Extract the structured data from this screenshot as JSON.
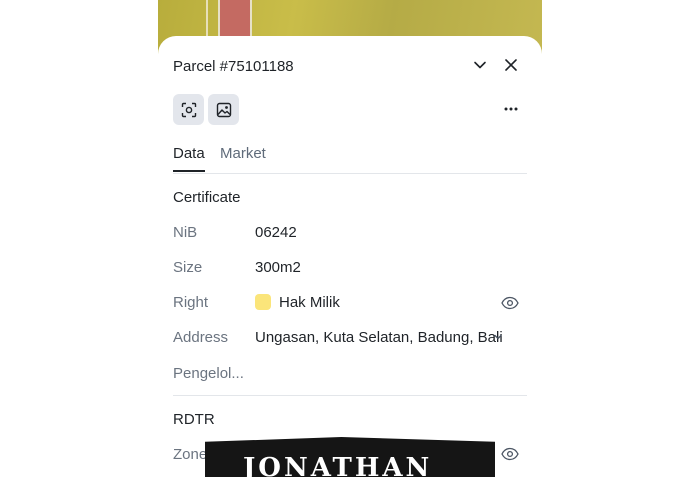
{
  "header": {
    "title": "Parcel #75101188"
  },
  "toolbar": {
    "select_icon": "focus-select-icon",
    "image_icon": "image-icon",
    "more_icon": "more-dots-icon"
  },
  "tabs": [
    {
      "label": "Data",
      "active": true
    },
    {
      "label": "Market",
      "active": false
    }
  ],
  "certificate": {
    "heading": "Certificate",
    "fields": [
      {
        "label": "NiB",
        "value": "06242"
      },
      {
        "label": "Size",
        "value": "300m2"
      },
      {
        "label": "Right",
        "value": "Hak Milik",
        "swatch_color": "#fbe57a"
      },
      {
        "label": "Address",
        "value": "Ungasan, Kuta Selatan, Badung, Bali"
      },
      {
        "label": "Pengelol...",
        "value": ""
      }
    ]
  },
  "rdtr": {
    "heading": "RDTR",
    "zone_label": "Zone"
  },
  "watermark": {
    "text": "JONATHAN"
  }
}
